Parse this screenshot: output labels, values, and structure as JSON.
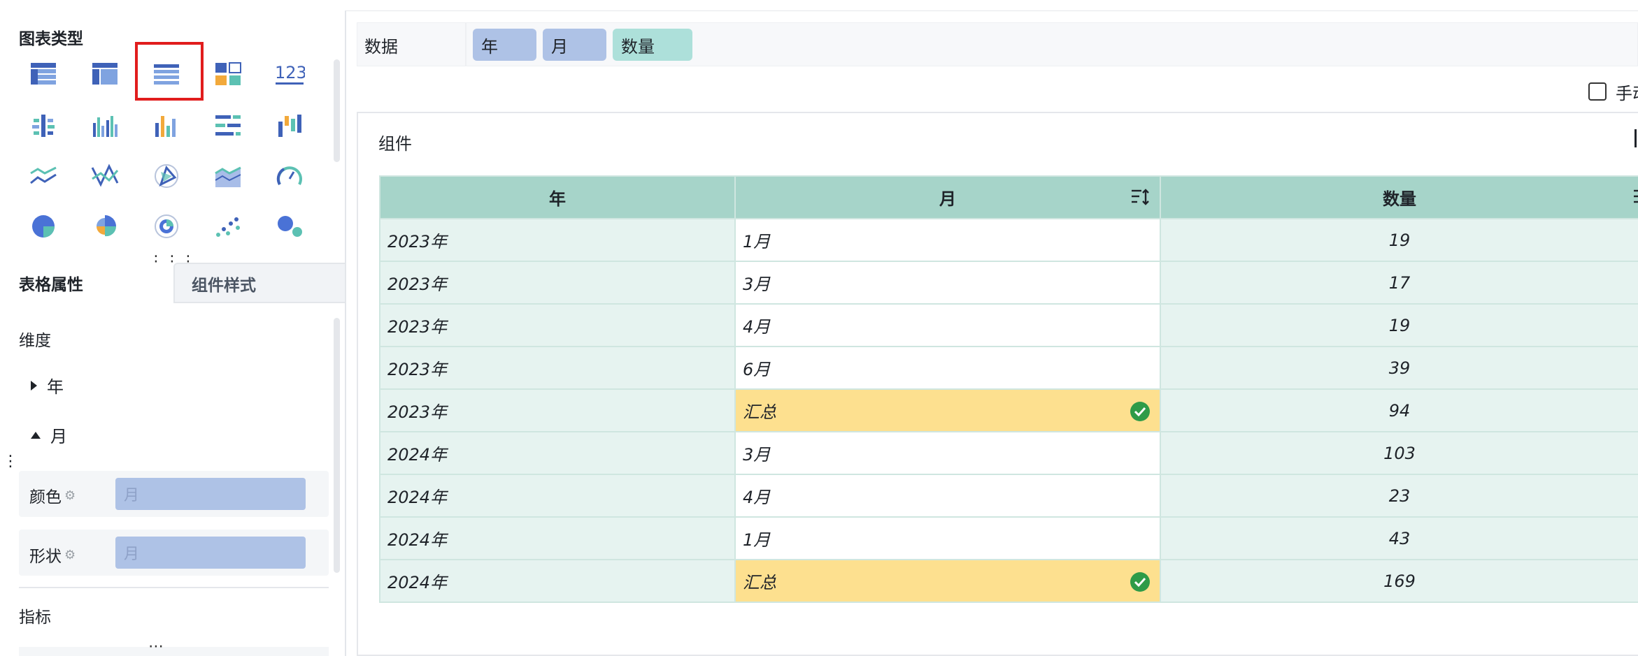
{
  "left_panel": {
    "chart_type_title": "图表类型",
    "chart_icons": [
      {
        "name": "table-detail-icon"
      },
      {
        "name": "table-cross-icon"
      },
      {
        "name": "table-summary-icon",
        "selected": true
      },
      {
        "name": "dashboard-block-icon"
      },
      {
        "name": "number-card-icon",
        "text": "123"
      },
      {
        "name": "bar-horizontal-icon"
      },
      {
        "name": "bar-grouped-icon"
      },
      {
        "name": "bar-color-icon"
      },
      {
        "name": "bar-horizontal-list-icon"
      },
      {
        "name": "bar-stacked-icon"
      },
      {
        "name": "line-chart-icon"
      },
      {
        "name": "line-cross-icon"
      },
      {
        "name": "radar-icon"
      },
      {
        "name": "area-chart-icon"
      },
      {
        "name": "gauge-icon"
      },
      {
        "name": "pie-chart-icon"
      },
      {
        "name": "rose-chart-icon"
      },
      {
        "name": "donut-chart-icon"
      },
      {
        "name": "scatter-chart-icon"
      },
      {
        "name": "bubble-chart-icon"
      }
    ],
    "tabs": [
      {
        "label": "表格属性",
        "active": true
      },
      {
        "label": "组件样式",
        "active": false
      }
    ],
    "dimension_label": "维度",
    "tree": [
      {
        "label": "年",
        "expanded": false
      },
      {
        "label": "月",
        "expanded": true
      }
    ],
    "props": [
      {
        "label": "颜色",
        "value": "月"
      },
      {
        "label": "形状",
        "value": "月"
      }
    ],
    "metrics_label": "指标"
  },
  "data_bar": {
    "label": "数据",
    "fields": [
      {
        "label": "年",
        "kind": "dimension"
      },
      {
        "label": "月",
        "kind": "dimension"
      },
      {
        "label": "数量",
        "kind": "metric"
      }
    ]
  },
  "manual_label": "手动",
  "component": {
    "title": "组件"
  },
  "table": {
    "headers": [
      "年",
      "月",
      "数量"
    ],
    "rows": [
      {
        "year": "2023年",
        "month": "1月",
        "qty": "19",
        "total": false
      },
      {
        "year": "2023年",
        "month": "3月",
        "qty": "17",
        "total": false
      },
      {
        "year": "2023年",
        "month": "4月",
        "qty": "19",
        "total": false
      },
      {
        "year": "2023年",
        "month": "6月",
        "qty": "39",
        "total": false
      },
      {
        "year": "2023年",
        "month": "汇总",
        "qty": "94",
        "total": true
      },
      {
        "year": "2024年",
        "month": "3月",
        "qty": "103",
        "total": false
      },
      {
        "year": "2024年",
        "month": "4月",
        "qty": "23",
        "total": false
      },
      {
        "year": "2024年",
        "month": "1月",
        "qty": "43",
        "total": false
      },
      {
        "year": "2024年",
        "month": "汇总",
        "qty": "169",
        "total": true
      }
    ]
  },
  "colors": {
    "header_bg": "#a6d4c9",
    "total_bg": "#fde08f",
    "check_green": "#2e9b48",
    "selection_red": "#e11d1d",
    "pill_blue": "#aec2e6",
    "pill_green": "#ade0da"
  }
}
